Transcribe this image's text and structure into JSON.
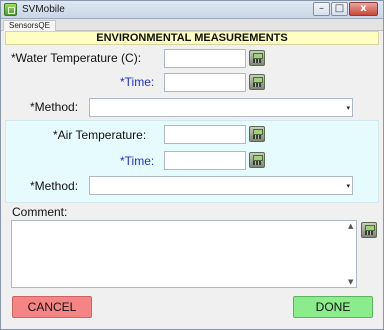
{
  "window": {
    "title": "SVMobile",
    "controls": [
      "–",
      "□",
      "x"
    ]
  },
  "tab": {
    "label": "SensorsQE"
  },
  "header": {
    "title": "ENVIRONMENTAL MEASUREMENTS"
  },
  "water": {
    "temperature_label": "*Water Temperature (C):",
    "temperature_value": "",
    "time_label": "*Time:",
    "time_value": "",
    "method_label": "*Method:",
    "method_value": ""
  },
  "air": {
    "temperature_label": "*Air Temperature:",
    "temperature_value": "",
    "time_label": "*Time:",
    "time_value": "",
    "method_label": "*Method:",
    "method_value": ""
  },
  "comment": {
    "label": "Comment:",
    "value": ""
  },
  "buttons": {
    "cancel": "CANCEL",
    "done": "DONE"
  },
  "colors": {
    "header_bg": "#fefec2",
    "air_panel_bg": "#e5fbfd",
    "required_blue": "#1f2fd4",
    "cancel_bg": "#f58585",
    "done_bg": "#8aec8a"
  }
}
